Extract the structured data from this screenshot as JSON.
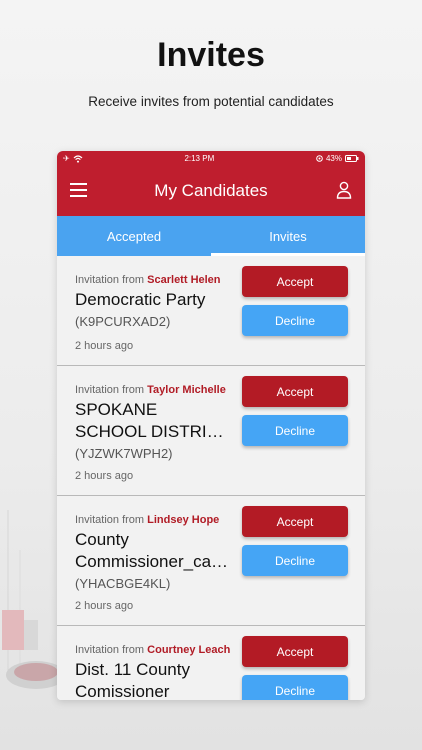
{
  "promo": {
    "title": "Invites",
    "subtitle": "Receive invites from potential candidates"
  },
  "statusbar": {
    "time": "2:13 PM",
    "battery": "43%"
  },
  "appbar": {
    "title": "My Candidates"
  },
  "tabs": [
    {
      "label": "Accepted",
      "active": false
    },
    {
      "label": "Invites",
      "active": true
    }
  ],
  "invites": [
    {
      "from_prefix": "Invitation from",
      "from_name": "Scarlett Helen",
      "party_lines": [
        "Democratic Party"
      ],
      "code": "(K9PCURXAD2)",
      "time": "2 hours ago",
      "accept": "Accept",
      "decline": "Decline"
    },
    {
      "from_prefix": "Invitation from",
      "from_name": "Taylor Michelle",
      "party_lines": [
        "SPOKANE",
        "SCHOOL DISTRI…"
      ],
      "code": "(YJZWK7WPH2)",
      "time": "2 hours ago",
      "accept": "Accept",
      "decline": "Decline"
    },
    {
      "from_prefix": "Invitation from",
      "from_name": "Lindsey Hope",
      "party_lines": [
        "County",
        "Commissioner_ca…"
      ],
      "code": "(YHACBGE4KL)",
      "time": "2 hours ago",
      "accept": "Accept",
      "decline": "Decline"
    },
    {
      "from_prefix": "Invitation from",
      "from_name": "Courtney Leach",
      "party_lines": [
        "Dist. 11 County",
        "Comissioner"
      ],
      "code": "",
      "time": "",
      "accept": "Accept",
      "decline": "Decline"
    }
  ],
  "colors": {
    "brand_red": "#bf1e2e",
    "tab_blue": "#4aa3f0",
    "accept_red": "#b31b25",
    "decline_blue": "#45a5f5"
  }
}
